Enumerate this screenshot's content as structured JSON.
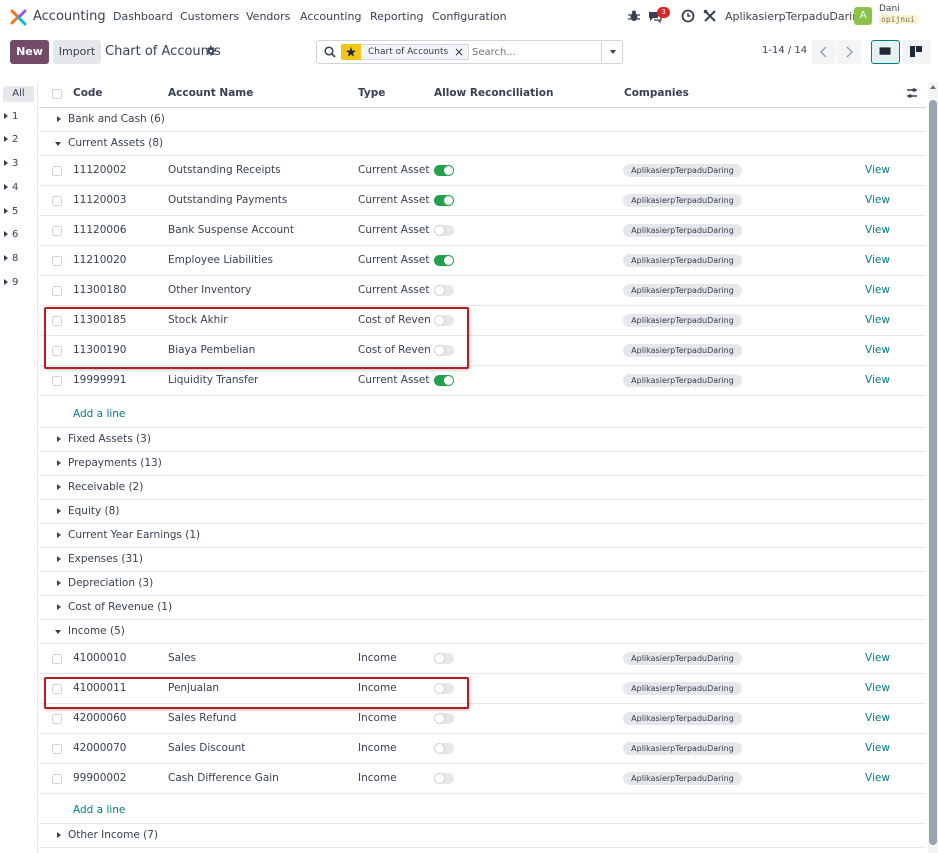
{
  "navbar": {
    "app_name": "Accounting",
    "menu": [
      "Dashboard",
      "Customers",
      "Vendors",
      "Accounting",
      "Reporting",
      "Configuration"
    ],
    "messages_count": "3",
    "company": "AplikasierpTerpaduDaring",
    "avatar_letter": "A",
    "user_name": "Dani",
    "user_db": "opijnui"
  },
  "control": {
    "new_label": "New",
    "import_label": "Import",
    "title": "Chart of Accounts",
    "search_facet": "Chart of Accounts",
    "search_placeholder": "Search...",
    "pager": "1-14 / 14"
  },
  "sidebar": {
    "all_label": "All",
    "items": [
      "1",
      "2",
      "3",
      "4",
      "5",
      "6",
      "8",
      "9"
    ]
  },
  "columns": {
    "code": "Code",
    "name": "Account Name",
    "type": "Type",
    "reconcile": "Allow Reconciliation",
    "companies": "Companies"
  },
  "groups": {
    "bank_cash": "Bank and Cash (6)",
    "current_assets": "Current Assets (8)",
    "fixed_assets": "Fixed Assets (3)",
    "prepayments": "Prepayments (13)",
    "receivable": "Receivable (2)",
    "equity": "Equity (8)",
    "cye": "Current Year Earnings (1)",
    "expenses": "Expenses (31)",
    "depreciation": "Depreciation (3)",
    "cost_revenue": "Cost of Revenue (1)",
    "income": "Income (5)",
    "other_income": "Other Income (7)"
  },
  "current_assets_rows": [
    {
      "code": "11120002",
      "name": "Outstanding Receipts",
      "type": "Current Assets",
      "reconcile": true,
      "company": "AplikasierpTerpaduDaring",
      "action": "View"
    },
    {
      "code": "11120003",
      "name": "Outstanding Payments",
      "type": "Current Assets",
      "reconcile": true,
      "company": "AplikasierpTerpaduDaring",
      "action": "View"
    },
    {
      "code": "11120006",
      "name": "Bank Suspense Account",
      "type": "Current Assets",
      "reconcile": false,
      "company": "AplikasierpTerpaduDaring",
      "action": "View"
    },
    {
      "code": "11210020",
      "name": "Employee Liabilities",
      "type": "Current Assets",
      "reconcile": true,
      "company": "AplikasierpTerpaduDaring",
      "action": "View"
    },
    {
      "code": "11300180",
      "name": "Other Inventory",
      "type": "Current Assets",
      "reconcile": false,
      "company": "AplikasierpTerpaduDaring",
      "action": "View"
    },
    {
      "code": "11300185",
      "name": "Stock Akhir",
      "type": "Cost of Revenue",
      "reconcile": false,
      "company": "AplikasierpTerpaduDaring",
      "action": "View"
    },
    {
      "code": "11300190",
      "name": "Biaya Pembelian",
      "type": "Cost of Revenue",
      "reconcile": false,
      "company": "AplikasierpTerpaduDaring",
      "action": "View"
    },
    {
      "code": "19999991",
      "name": "Liquidity Transfer",
      "type": "Current Assets",
      "reconcile": true,
      "company": "AplikasierpTerpaduDaring",
      "action": "View"
    }
  ],
  "income_rows": [
    {
      "code": "41000010",
      "name": "Sales",
      "type": "Income",
      "reconcile": false,
      "company": "AplikasierpTerpaduDaring",
      "action": "View"
    },
    {
      "code": "41000011",
      "name": "Penjualan",
      "type": "Income",
      "reconcile": false,
      "company": "AplikasierpTerpaduDaring",
      "action": "View"
    },
    {
      "code": "42000060",
      "name": "Sales Refund",
      "type": "Income",
      "reconcile": false,
      "company": "AplikasierpTerpaduDaring",
      "action": "View"
    },
    {
      "code": "42000070",
      "name": "Sales Discount",
      "type": "Income",
      "reconcile": false,
      "company": "AplikasierpTerpaduDaring",
      "action": "View"
    },
    {
      "code": "99900002",
      "name": "Cash Difference Gain",
      "type": "Income",
      "reconcile": false,
      "company": "AplikasierpTerpaduDaring",
      "action": "View"
    }
  ],
  "add_line_label": "Add a line",
  "colors": {
    "brand": "#714b67",
    "toggle_on": "#22a04a",
    "link": "#017e84",
    "highlight": "#b91c1c"
  }
}
